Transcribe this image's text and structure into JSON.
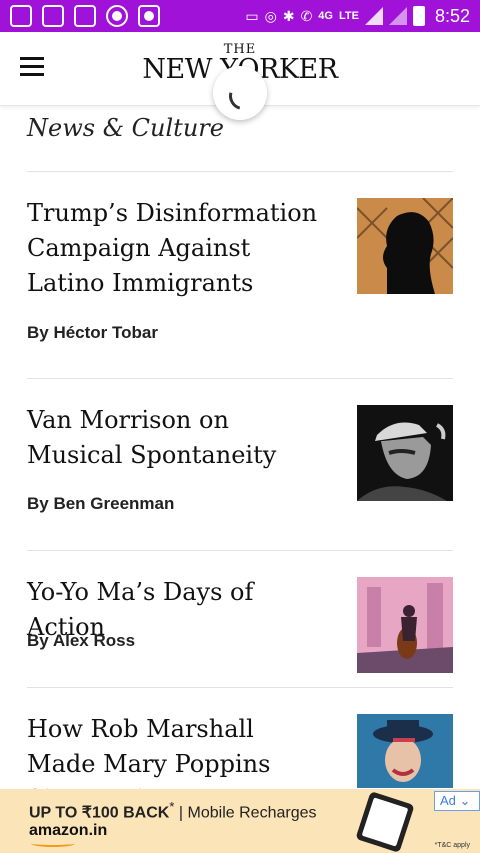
{
  "status_bar": {
    "time": "8:52",
    "network_badge": "4G",
    "lte_label": "LTE",
    "left_icons": [
      "notification-icon",
      "phone-sync-icon",
      "activity-icon",
      "circle-app-icon",
      "target-app-icon"
    ],
    "right_icons": [
      "cast-icon",
      "hotspot-icon",
      "bluetooth-icon",
      "wifi-call-icon",
      "signal-icon",
      "signal-icon",
      "battery-charging-icon"
    ]
  },
  "app_bar": {
    "logo_top": "THE",
    "logo_main": "NEW YORKER",
    "menu_icon": "hamburger-menu-icon"
  },
  "section": {
    "title": "News & Culture"
  },
  "articles": [
    {
      "headline": "Trump’s Disinformation Campaign Against Latino Immigrants",
      "byline": "By Héctor Tobar"
    },
    {
      "headline": "Van Morrison on Musical Spontaneity",
      "byline": "By Ben Greenman"
    },
    {
      "headline": "Yo-Yo Ma’s Days of Action",
      "byline": "By Alex Ross"
    },
    {
      "headline": "How Rob Marshall Made Mary Poppins Sing Again",
      "byline": ""
    }
  ],
  "ad": {
    "line1_bold": "UP TO ₹100 BACK",
    "line1_sup": "*",
    "line1_rest": " | Mobile Recharges",
    "brand": "amazon.in",
    "badge": "Ad ⌄",
    "terms": "*T&C apply"
  },
  "colors": {
    "status_bar": "#a012d8",
    "ad_background": "#fbe4b8",
    "amazon_smile": "#f29a1a"
  }
}
